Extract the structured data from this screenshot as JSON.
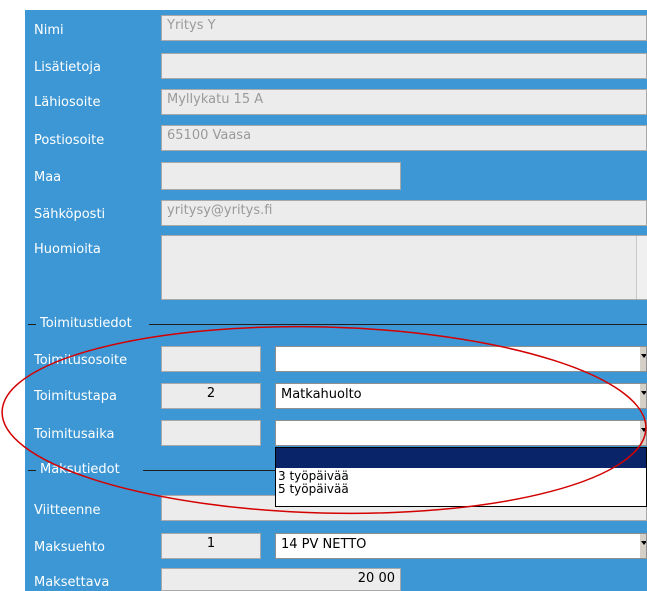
{
  "form": {
    "nimi": {
      "label": "Nimi",
      "value": "Yritys Y"
    },
    "lisatietoja": {
      "label": "Lisätietoja",
      "value": ""
    },
    "lahiosoite": {
      "label": "Lähiosoite",
      "value": "Myllykatu 15 A"
    },
    "postiosoite": {
      "label": "Postiosoite",
      "value": "65100 Vaasa"
    },
    "maa": {
      "label": "Maa",
      "value": ""
    },
    "sahkoposti": {
      "label": "Sähköposti",
      "value": "yritysy@yritys.fi"
    },
    "huomioita": {
      "label": "Huomioita",
      "value": ""
    }
  },
  "toimitustiedot": {
    "legend": "Toimitustiedot",
    "toimitusosoite": {
      "label": "Toimitusosoite",
      "code": "",
      "selected": ""
    },
    "toimitustapa": {
      "label": "Toimitustapa",
      "code": "2",
      "selected": "Matkahuolto"
    },
    "toimitusaika": {
      "label": "Toimitusaika",
      "code": "",
      "selected": "",
      "options": [
        "",
        "3 työpäivää",
        "5 työpäivää"
      ]
    }
  },
  "maksutiedot": {
    "legend": "Maksutiedot",
    "viitteenne": {
      "label": "Viitteenne",
      "value": ""
    },
    "maksuehto": {
      "label": "Maksuehto",
      "code": "1",
      "selected": "14 PV NETTO"
    },
    "maksettava": {
      "label": "Maksettava",
      "value": "20 00"
    }
  },
  "colors": {
    "panel": "#3c97d4",
    "annotation": "#d40000",
    "highlight": "#0a246a"
  }
}
